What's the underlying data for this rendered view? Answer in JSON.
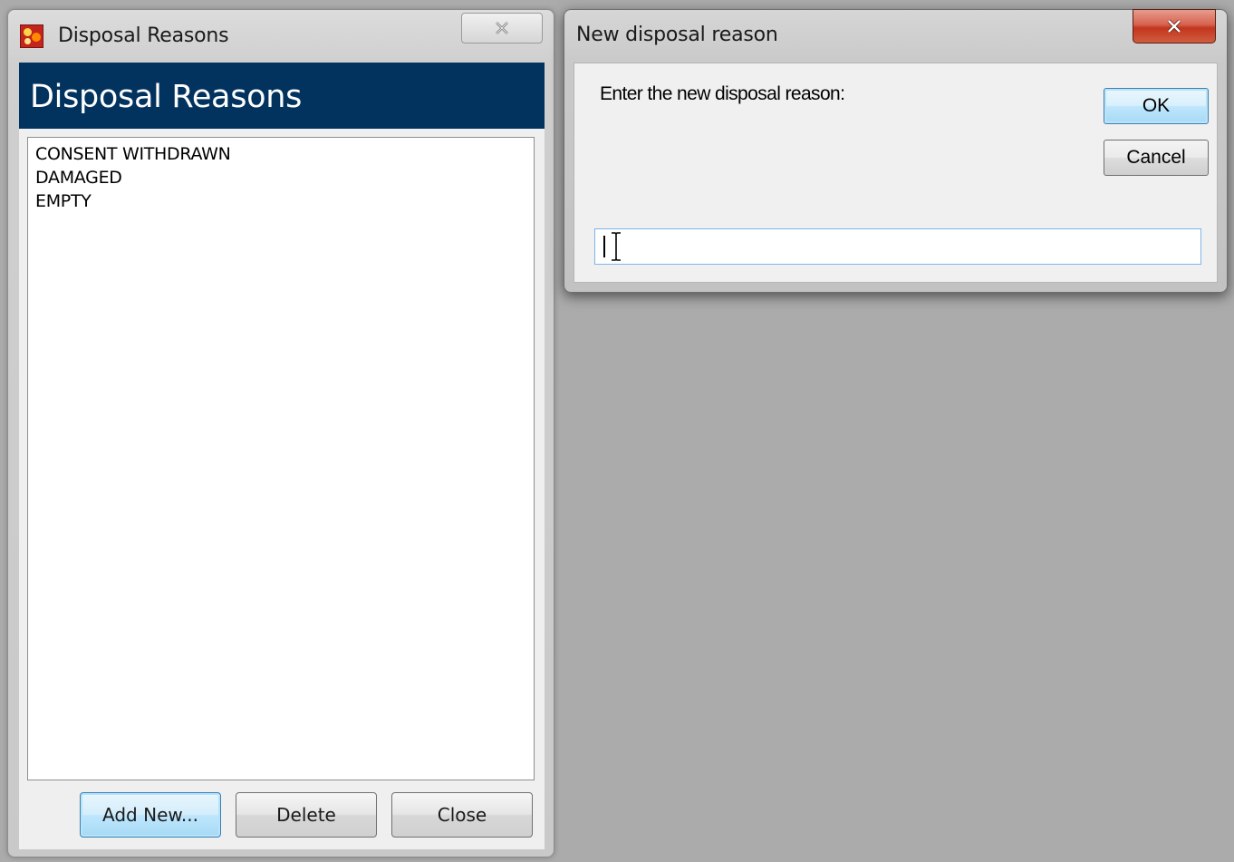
{
  "left_window": {
    "title": "Disposal Reasons",
    "header": "Disposal Reasons",
    "list_items": [
      "CONSENT WITHDRAWN",
      "DAMAGED",
      "EMPTY"
    ],
    "buttons": {
      "add_new": "Add New...",
      "delete": "Delete",
      "close": "Close"
    },
    "header_color": "#02335f",
    "icons": {
      "app": "app-logo-icon",
      "close": "close-icon"
    }
  },
  "dialog": {
    "title": "New disposal reason",
    "prompt": "Enter the new disposal reason:",
    "ok_label": "OK",
    "cancel_label": "Cancel",
    "input_value": "",
    "icons": {
      "close": "close-icon"
    },
    "close_button_color": "#c2361d"
  }
}
